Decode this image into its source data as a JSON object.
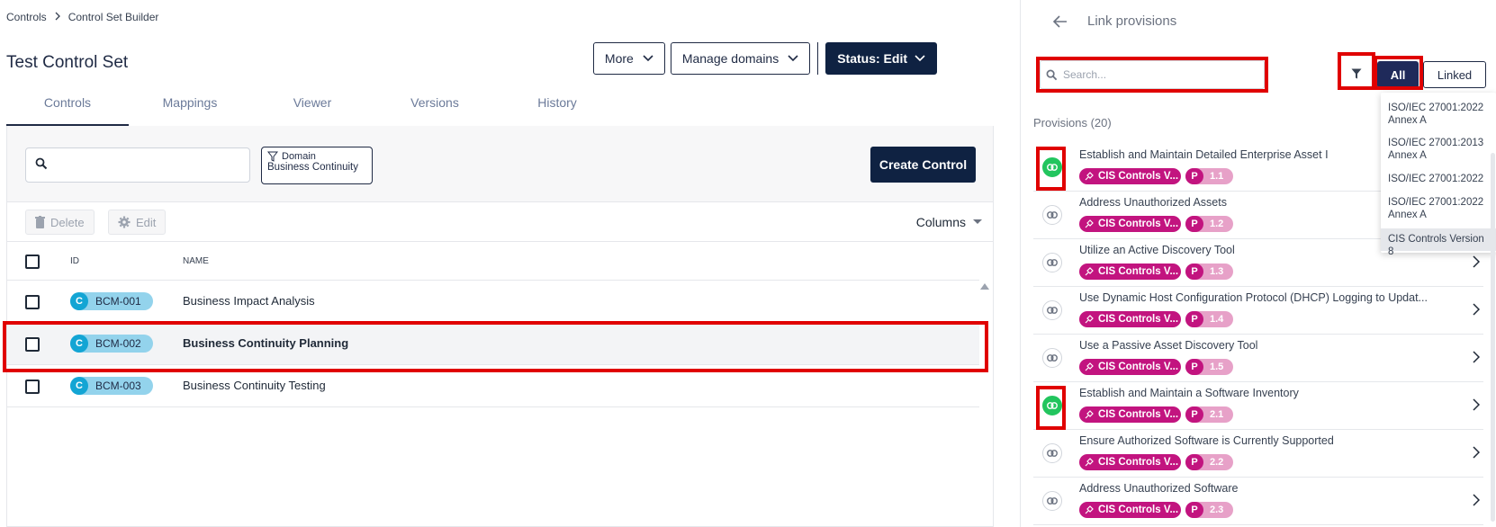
{
  "breadcrumb": {
    "root": "Controls",
    "current": "Control Set Builder"
  },
  "page": {
    "title": "Test Control Set"
  },
  "actions": {
    "more": "More",
    "manage_domains": "Manage domains",
    "status": "Status: Edit"
  },
  "tabs": [
    {
      "label": "Controls"
    },
    {
      "label": "Mappings"
    },
    {
      "label": "Viewer"
    },
    {
      "label": "Versions"
    },
    {
      "label": "History"
    }
  ],
  "filters": {
    "domain_label": "Domain",
    "domain_value": "Business Continuity"
  },
  "create_control": "Create Control",
  "toolbar": {
    "delete": "Delete",
    "edit": "Edit",
    "columns": "Columns"
  },
  "table": {
    "headers": {
      "id": "ID",
      "name": "NAME"
    },
    "rows": [
      {
        "prefix": "C",
        "id": "BCM-001",
        "name": "Business Impact Analysis"
      },
      {
        "prefix": "C",
        "id": "BCM-002",
        "name": "Business Continuity Planning"
      },
      {
        "prefix": "C",
        "id": "BCM-003",
        "name": "Business Continuity Testing"
      }
    ]
  },
  "link_panel": {
    "title": "Link provisions",
    "search_placeholder": "Search...",
    "seg_all": "All",
    "seg_linked": "Linked",
    "count_label": "Provisions (20)",
    "tag_label": "CIS Controls V...",
    "tag_p": "P",
    "provisions": [
      {
        "title": "Establish and Maintain Detailed Enterprise Asset I",
        "num": "1.1",
        "linked": true
      },
      {
        "title": "Address Unauthorized Assets",
        "num": "1.2",
        "linked": false
      },
      {
        "title": "Utilize an Active Discovery Tool",
        "num": "1.3",
        "linked": false
      },
      {
        "title": "Use Dynamic Host Configuration Protocol (DHCP) Logging to Updat...",
        "num": "1.4",
        "linked": false
      },
      {
        "title": "Use a Passive Asset Discovery Tool",
        "num": "1.5",
        "linked": false
      },
      {
        "title": "Establish and Maintain a Software Inventory",
        "num": "2.1",
        "linked": true
      },
      {
        "title": "Ensure Authorized Software is Currently Supported",
        "num": "2.2",
        "linked": false
      },
      {
        "title": "Address Unauthorized Software",
        "num": "2.3",
        "linked": false
      }
    ],
    "framework_menu": [
      {
        "line1": "ISO/IEC 27001:2022",
        "line2": "Annex A"
      },
      {
        "line1": "ISO/IEC 27001:2013",
        "line2": "Annex A"
      },
      {
        "line1": "ISO/IEC 27001:2022",
        "line2": ""
      },
      {
        "line1": "ISO/IEC 27001:2022",
        "line2": "Annex A"
      },
      {
        "line1": "CIS Controls Version 8",
        "line2": ""
      }
    ]
  },
  "colors": {
    "primary": "#0f2242",
    "accent_red": "#e00000",
    "tag": "#c2147f",
    "link_on": "#22c55e",
    "badge": "#13a5d4"
  }
}
